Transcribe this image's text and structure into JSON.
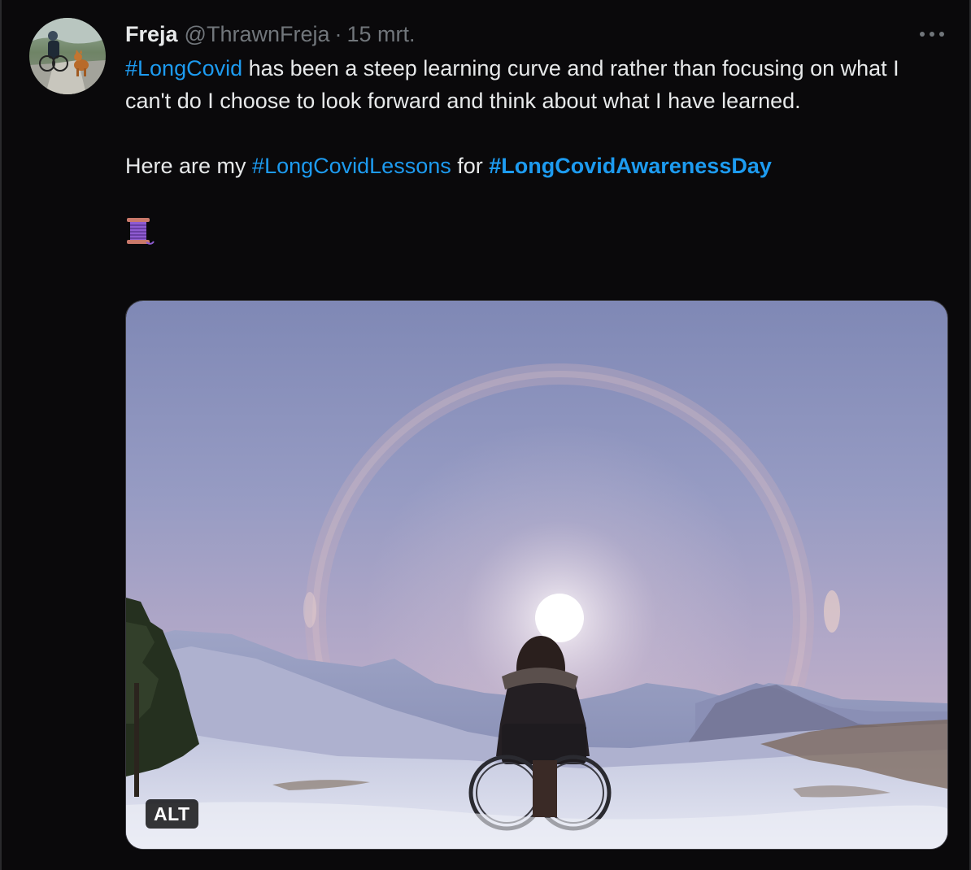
{
  "tweet": {
    "author_name": "Freja",
    "handle": "@ThrawnFreja",
    "separator": "·",
    "date": "15 mrt.",
    "more_icon": "more-horizontal-icon",
    "text": {
      "line1_hashtag": "#LongCovid",
      "line1_rest": " has been a steep learning curve and rather than focusing on what I can't do I choose to look forward and think about what I have learned.",
      "line2_prefix": "Here are my ",
      "line2_hashtag1": "#LongCovidLessons",
      "line2_mid": " for ",
      "line2_hashtag2": "#LongCovidAwarenessDay",
      "thread_emoji": "thread-spool-icon"
    },
    "media": {
      "alt_label": "ALT"
    }
  },
  "colors": {
    "background": "#0a090b",
    "text": "#e7e9ea",
    "secondary": "#71767b",
    "link": "#1d9bf0"
  }
}
